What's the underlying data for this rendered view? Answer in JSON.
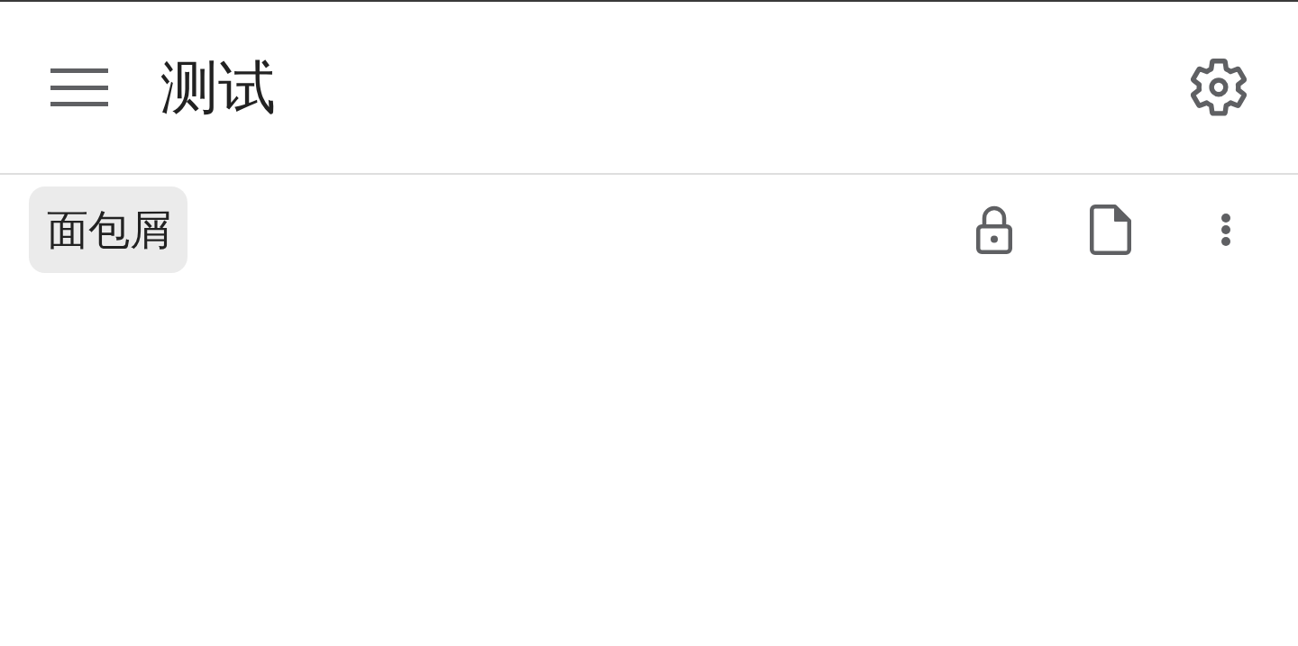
{
  "app_bar": {
    "title": "测试"
  },
  "breadcrumb": {
    "label": "面包屑"
  }
}
